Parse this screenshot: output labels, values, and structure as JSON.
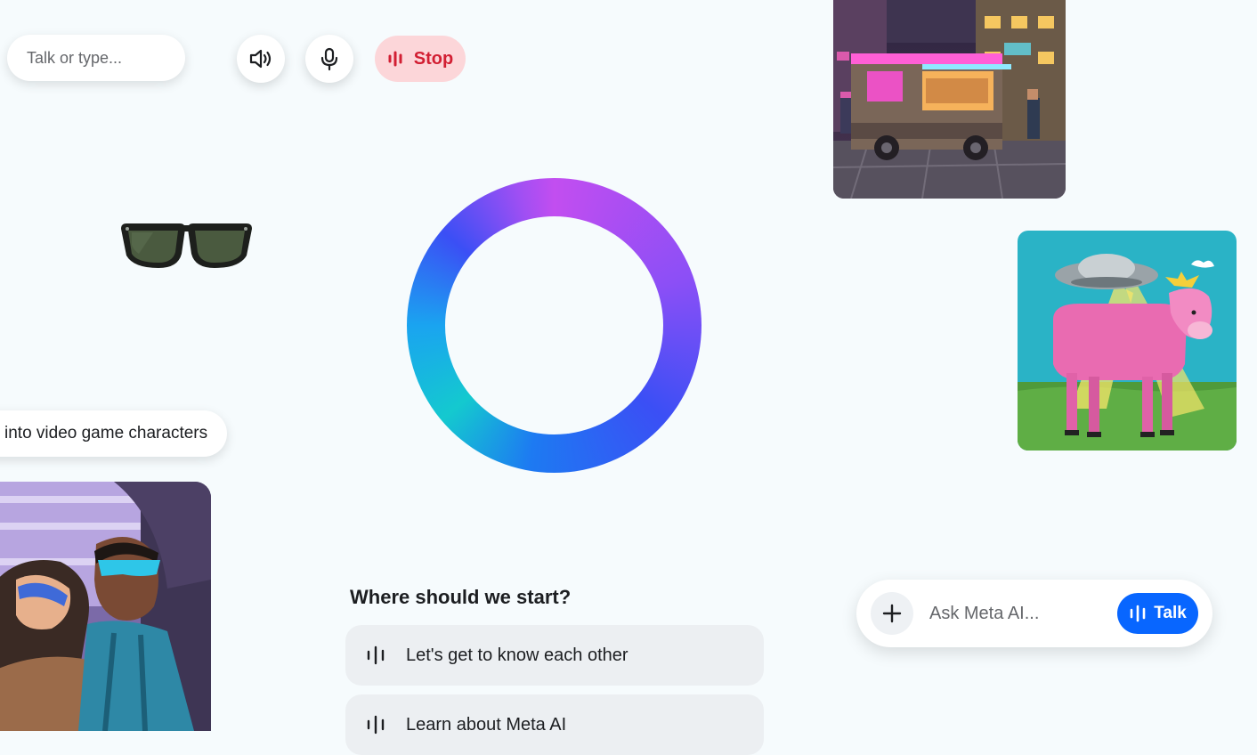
{
  "controls": {
    "talk_placeholder": "Talk or type...",
    "stop_label": "Stop",
    "speaker_icon": "speaker-icon",
    "mic_icon": "microphone-icon"
  },
  "chip": {
    "text": "into video game characters"
  },
  "prompt": {
    "heading": "Where should we start?",
    "suggestions": [
      {
        "label": "Let's get to know each other",
        "icon": "voice-wave-icon"
      },
      {
        "label": "Learn about Meta AI",
        "icon": "voice-wave-icon"
      }
    ]
  },
  "askbar": {
    "placeholder": "Ask Meta AI...",
    "talk_label": "Talk",
    "add_icon": "plus-icon"
  },
  "colors": {
    "background": "#f6fbfd",
    "stop_bg": "#fcd6d9",
    "stop_text": "#d21f33",
    "talk_button": "#0866ff",
    "ring_colors": [
      "#c24ef0",
      "#3b4ff5",
      "#1aa4f0",
      "#14c9cf"
    ]
  },
  "images": {
    "food_truck": "pixel-art-neon-food-truck",
    "cow": "pink-cow-under-ufo",
    "sunglasses": "black-sunglasses",
    "characters": "video-game-characters-with-visors"
  }
}
